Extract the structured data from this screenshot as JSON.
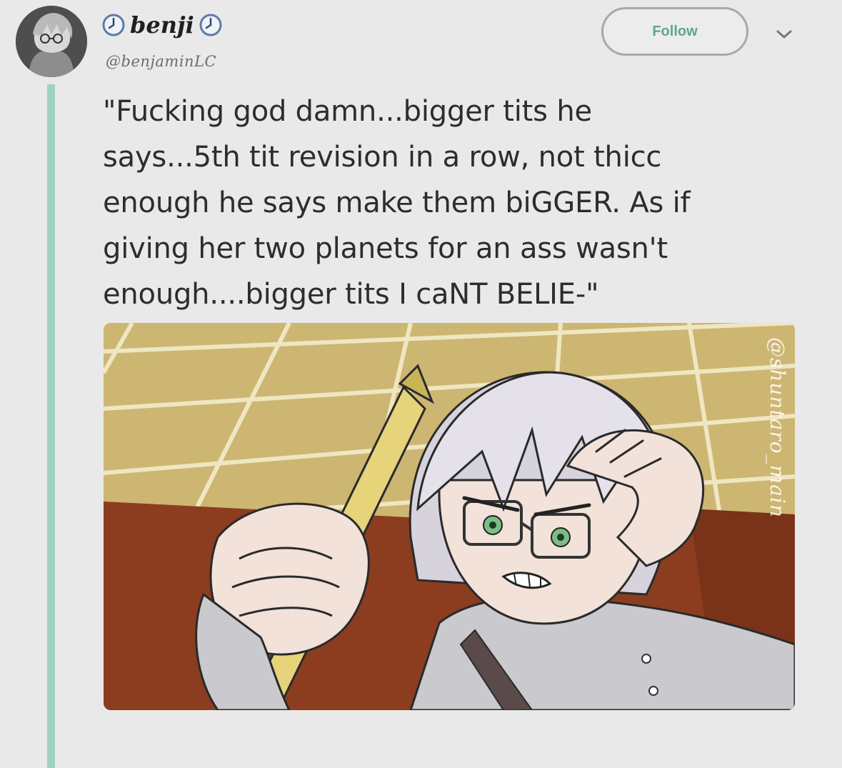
{
  "tweet": {
    "display_name": "benji",
    "handle": "@benjaminLC",
    "follow_label": "Follow",
    "text": "\"Fucking god damn...bigger tits he says...5th tit revision in a row, not thicc enough he says make them biGGER. As if giving her two planets for an ass wasn't enough....bigger tits I caNT BELIE-\"",
    "text_lines": [
      "\"Fucking god damn...bigger tits he",
      "says...5th tit revision in a row, not thicc",
      "enough he says make them biGGER. As if",
      "giving her two planets for an ass wasn't",
      "enough....bigger tits I caNT BELIE-\""
    ]
  },
  "media": {
    "watermark": "@shuntaro_main"
  },
  "icons": {
    "name_prefix": "clock-icon",
    "name_suffix": "clock-icon",
    "more": "chevron-down-icon"
  },
  "colors": {
    "background": "#e9e9e9",
    "thread_line": "#9fd3c0",
    "follow_text": "#5fa58e",
    "text": "#2d2d2d"
  }
}
